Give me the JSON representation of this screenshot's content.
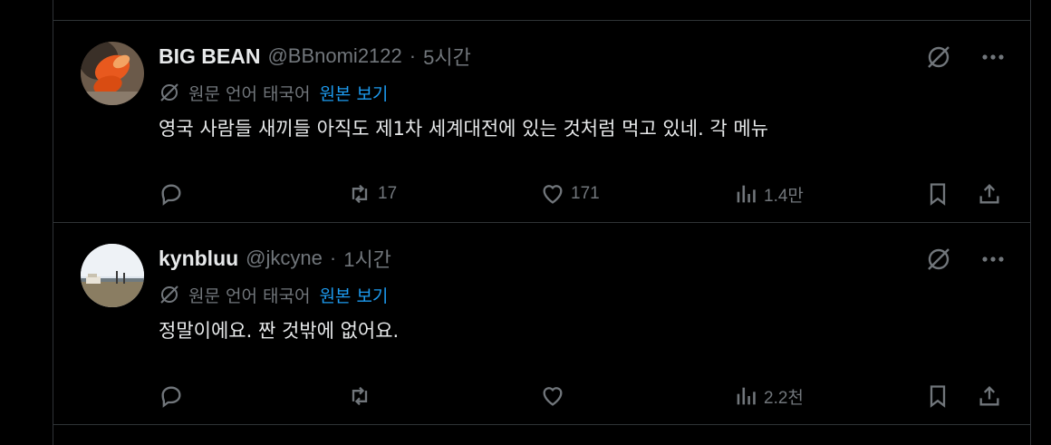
{
  "posts": [
    {
      "display_name": "BIG BEAN",
      "handle": "@BBnomi2122",
      "separator": "·",
      "time": "5시간",
      "translation_note": "원문 언어 태국어",
      "show_original": "원본 보기",
      "text": "영국 사람들 새끼들 아직도 제1차 세계대전에 있는 것처럼 먹고 있네. 각 메뉴",
      "reply_count": "",
      "repost_count": "17",
      "like_count": "171",
      "view_count": "1.4만",
      "avatar_icon": "orange-food-avatar"
    },
    {
      "display_name": "kynbluu",
      "handle": "@jkcyne",
      "separator": "·",
      "time": "1시간",
      "translation_note": "원문 언어 태국어",
      "show_original": "원본 보기",
      "text": "정말이에요. 짠 것밖에 없어요.",
      "reply_count": "",
      "repost_count": "",
      "like_count": "",
      "view_count": "2.2천",
      "avatar_icon": "landscape-photo-avatar"
    }
  ],
  "icons": {
    "translate": "globe-slash-icon",
    "more": "more-dots-icon",
    "reply": "reply-bubble-icon",
    "repost": "repost-arrows-icon",
    "like": "heart-icon",
    "views": "bar-chart-icon",
    "bookmark": "bookmark-icon",
    "share": "share-upload-icon"
  },
  "colors": {
    "background": "#000000",
    "text": "#e7e9ea",
    "muted": "#71767b",
    "link": "#1d9bf0",
    "border": "#2f3336"
  }
}
